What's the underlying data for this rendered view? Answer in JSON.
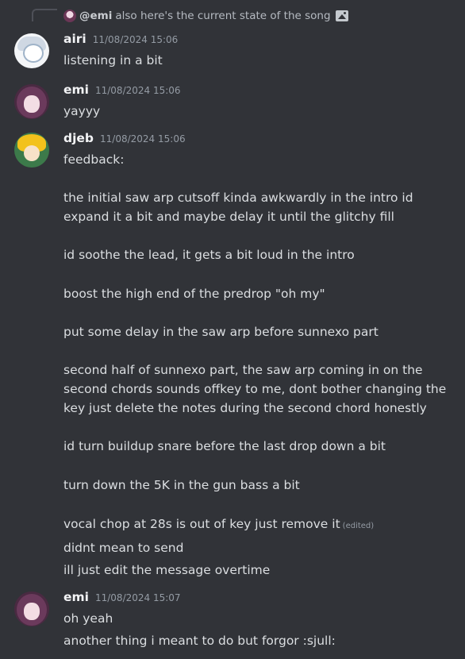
{
  "reply": {
    "author": "@emi",
    "text": "also here's the current state of the song"
  },
  "messages": [
    {
      "username": "airi",
      "timestamp": "11/08/2024 15:06",
      "lines": [
        "listening in a bit"
      ]
    },
    {
      "username": "emi",
      "timestamp": "11/08/2024 15:06",
      "lines": [
        "yayyy"
      ]
    },
    {
      "username": "djeb",
      "timestamp": "11/08/2024 15:06",
      "lines": [
        "feedback:",
        "",
        "the initial saw arp cutsoff kinda awkwardly in the intro id",
        "expand it a bit and maybe delay it until the glitchy fill",
        "",
        "id soothe the lead, it gets a bit loud in the intro",
        "",
        "boost the high end of the predrop \"oh my\"",
        "",
        "put some delay in the saw arp before sunnexo part",
        "",
        "second half of sunnexo part, the saw arp coming in on the",
        "second chords sounds offkey to me, dont bother changing the",
        "key just delete the notes during the second chord honestly",
        "",
        "id turn buildup snare before the last drop down a bit",
        "",
        "turn down the 5K in the gun bass a bit",
        "",
        "vocal chop at 28s is out of key just remove it"
      ],
      "edited_label": "(edited)",
      "followups": [
        "didnt mean to send",
        "ill just edit the message overtime"
      ]
    },
    {
      "username": "emi",
      "timestamp": "11/08/2024 15:07",
      "lines": [
        "oh yeah"
      ],
      "followups": [
        "another thing i meant to do but forgor :sjull:"
      ]
    }
  ]
}
